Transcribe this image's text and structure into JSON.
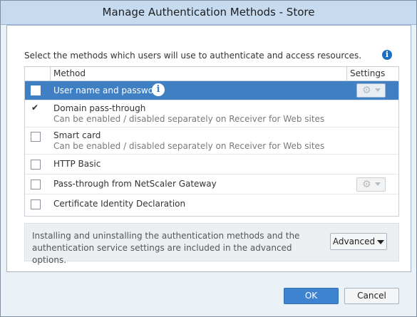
{
  "window": {
    "title": "Manage Authentication Methods - Store"
  },
  "instructions": "Select the methods which users will use to authenticate and access resources.",
  "table": {
    "headers": {
      "method": "Method",
      "settings": "Settings"
    },
    "rows": [
      {
        "name": "User name and password",
        "sub": "",
        "checked": false,
        "selected": true,
        "has_settings": true,
        "has_info": true
      },
      {
        "name": "Domain pass-through",
        "sub": "Can be enabled / disabled separately on Receiver for Web sites",
        "checked": true,
        "selected": false,
        "has_settings": false
      },
      {
        "name": "Smart card",
        "sub": "Can be enabled / disabled separately on Receiver for Web sites",
        "checked": false,
        "selected": false,
        "has_settings": false
      },
      {
        "name": "HTTP Basic",
        "sub": "",
        "checked": false,
        "selected": false,
        "has_settings": false
      },
      {
        "name": "Pass-through from NetScaler Gateway",
        "sub": "",
        "checked": false,
        "selected": false,
        "has_settings": true
      },
      {
        "name": "Certificate Identity Declaration",
        "sub": "",
        "checked": false,
        "selected": false,
        "has_settings": false
      }
    ]
  },
  "advanced": {
    "text": "Installing and uninstalling the authentication methods and the authentication service settings are included in the advanced options.",
    "button": "Advanced"
  },
  "footer": {
    "ok": "OK",
    "cancel": "Cancel"
  },
  "icons": {
    "info": "info-icon",
    "gear": "gear-icon",
    "check": "checkmark-icon"
  },
  "colors": {
    "selected_row": "#3f7fc4",
    "title_bar": "#c6daf0",
    "primary_button": "#3f84d0"
  }
}
